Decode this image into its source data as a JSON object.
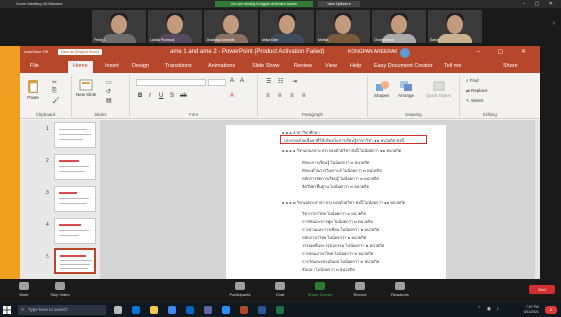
{
  "zoom": {
    "window_title": "Zoom Meeting 40-Minutes",
    "banner": "You are viewing Kongpan Areerak's screen",
    "view_options": "View Options ▾",
    "participants": [
      {
        "name": "Ferdy 1"
      },
      {
        "name": "Ladda Poonsuk"
      },
      {
        "name": "Jirachaya Arsewat"
      },
      {
        "name": "aitiya Kam"
      },
      {
        "name": "Marika"
      },
      {
        "name": "Chompunoot"
      },
      {
        "name": "KONGPAN AREERAK"
      },
      {
        "name": "Sarun"
      }
    ],
    "controls": [
      {
        "label": "Mute"
      },
      {
        "label": "Stop Video"
      },
      {
        "label": "Participants"
      },
      {
        "label": "Chat"
      },
      {
        "label": "Share Screen"
      },
      {
        "label": "Record"
      },
      {
        "label": "Reactions"
      }
    ],
    "end_label": "End"
  },
  "ppt": {
    "quick_access": "AutoSave  Off",
    "save_chip": "Save as (Original Scroll)",
    "doc_title": "ame 1 and ame 2  -  PowerPoint (Product Activation Failed)",
    "user_name": "KONGPAN AREERAK",
    "tabs": [
      "File",
      "Home",
      "Insert",
      "Design",
      "Transitions",
      "Animations",
      "Slide Show",
      "Review",
      "View",
      "Help",
      "Easy Document Creator",
      "Tell me",
      "Share"
    ],
    "ribbon": {
      "paste": "Paste",
      "new_slide": "New Slide",
      "groups": [
        "Clipboard",
        "Slides",
        "Font",
        "Paragraph",
        "Drawing",
        "Editing"
      ],
      "shapes": "Shapes",
      "arrange": "Arrange",
      "quick_styles": "Quick Styles",
      "find": "Find",
      "replace": "Replace",
      "select": "Select"
    },
    "thumb_numbers": [
      "1",
      "2",
      "3",
      "4",
      "5"
    ],
    "slide_lines": [
      "๑.๑.๑    สาขาวิชาศึกษา",
      "ประกอบด้วยเนื้อหาที่ใช้บริบทในการเรียนรู้สาขาวิชา   ๑๒   หน่วยกิต  ดังนี้",
      "๑.๑.๑.๑ วิชาแกนกลาง ประกอบด้วยวิชา ดังนี้ ไม่น้อยกว่า  ๑๒     หน่วยกิต",
      "ทักษะการเรียนรู้   ไม่น้อยกว่า  ๓   หน่วยกิต",
      "ทักษะด้านการวิเคราะห์   ไม่น้อยกว่า  ๓   หน่วยกิต",
      "หลักการจัดการเรียนรู้   ไม่น้อยกว่า  ๓   หน่วยกิต",
      "จิตวิทยาพื้นฐาน   ไม่น้อยกว่า  ๓   หน่วยกิต",
      "๑.๑.๑.๒ วิชาเฉพาะสาขา ประกอบด้วยวิชา ดังนี้ ไม่น้อยกว่า  ๑๑  หน่วยกิต",
      "วิชาภาษาไทย   ไม่น้อยกว่า  ๓   หน่วยกิต",
      "การฟังและการพูด   ไม่น้อยกว่า  ๓   หน่วยกิต",
      "การอ่านและการเขียน   ไม่น้อยกว่า  ๒   หน่วยกิต",
      "หลักภาษาไทย   ไม่น้อยกว่า  ๒   หน่วยกิต",
      "วรรณคดีและวรรณกรรม   ไม่น้อยกว่า  ๒   หน่วยกิต",
      "การสอนภาษาไทย   ไม่น้อยกว่า  ๓   หน่วยกิต",
      "การวัดและประเมินผล   ไม่น้อยกว่า  ๓   หน่วยกิต",
      "สัมมนา   ไม่น้อยกว่า  ๓   หน่วยกิต"
    ]
  },
  "taskbar": {
    "search_placeholder": "Type here to search",
    "time": "7:07 PM",
    "date": "6/11/2021",
    "notif": "8"
  },
  "colors": {
    "ppt_accent": "#b7472a",
    "zoom_share_border": "#f0a020",
    "highlight_box": "#d32f2f"
  }
}
